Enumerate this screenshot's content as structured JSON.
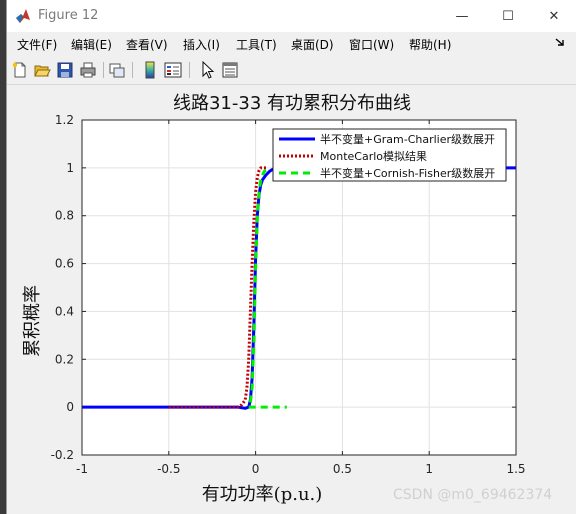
{
  "window": {
    "title": "Figure 12",
    "controls": {
      "minimize": "—",
      "maximize": "☐",
      "close": "✕"
    }
  },
  "menubar": {
    "items": [
      "文件(F)",
      "编辑(E)",
      "查看(V)",
      "插入(I)",
      "工具(T)",
      "桌面(D)",
      "窗口(W)",
      "帮助(H)"
    ],
    "dock_icon": "dock-arrow-icon"
  },
  "toolbar": {
    "icons": [
      "new-figure-icon",
      "open-file-icon",
      "save-icon",
      "print-icon",
      "link-plot-icon",
      "insert-colorbar-icon",
      "insert-legend-icon",
      "edit-plot-arrow-icon",
      "property-inspector-icon"
    ]
  },
  "watermark": "CSDN @m0_69462374",
  "colors": {
    "series1": "#0000ff",
    "series2": "#c00000",
    "series3": "#00ee00"
  },
  "chart_data": {
    "type": "line",
    "title": "线路31-33 有功累积分布曲线",
    "xlabel": "有功功率(p.u.)",
    "ylabel": "累积概率",
    "xlim": [
      -1,
      1.5
    ],
    "ylim": [
      -0.2,
      1.2
    ],
    "xticks": [
      -1,
      -0.5,
      0,
      0.5,
      1,
      1.5
    ],
    "yticks": [
      -0.2,
      0,
      0.2,
      0.4,
      0.6,
      0.8,
      1,
      1.2
    ],
    "xtick_labels": [
      "-1",
      "-0.5",
      "0",
      "0.5",
      "1",
      "1.5"
    ],
    "ytick_labels": [
      "-0.2",
      "0",
      "0.2",
      "0.4",
      "0.6",
      "0.8",
      "1",
      "1.2"
    ],
    "grid": true,
    "legend_position": "top-right",
    "series": [
      {
        "name": "半不变量+Gram-Charlier级数展开",
        "style": "solid",
        "color": "#0000ff",
        "x": [
          -1,
          -0.5,
          -0.1,
          -0.06,
          -0.04,
          -0.03,
          -0.02,
          -0.01,
          0,
          0.01,
          0.02,
          0.03,
          0.04,
          0.06,
          0.08,
          0.1,
          0.15,
          0.2,
          0.5,
          1,
          1.5
        ],
        "y": [
          0,
          0,
          0,
          -0.005,
          0,
          0.03,
          0.12,
          0.35,
          0.62,
          0.8,
          0.89,
          0.93,
          0.95,
          0.97,
          0.985,
          0.995,
          1,
          1,
          1,
          1,
          1
        ]
      },
      {
        "name": "MonteCarlo模拟结果",
        "style": "dotted",
        "color": "#c00000",
        "x": [
          -0.5,
          -0.1,
          -0.08,
          -0.06,
          -0.05,
          -0.04,
          -0.03,
          -0.02,
          -0.01,
          0,
          0.01,
          0.02,
          0.03,
          0.04,
          0.06
        ],
        "y": [
          0,
          0,
          0.01,
          0.03,
          0.08,
          0.2,
          0.4,
          0.6,
          0.78,
          0.9,
          0.96,
          0.99,
          1,
          1,
          1
        ]
      },
      {
        "name": "半不变量+Cornish-Fisher级数展开",
        "style": "dashed",
        "color": "#00ee00",
        "x": [
          -0.04,
          0.0,
          0.1,
          0.18
        ],
        "y": [
          0,
          0,
          0,
          0
        ]
      },
      {
        "name": "半不变量+Cornish-Fisher级数展开",
        "style": "dashed",
        "color": "#00ee00",
        "x": [
          -0.03,
          -0.02,
          -0.01,
          0,
          0.01,
          0.02,
          0.03,
          0.04,
          0.05,
          0.06
        ],
        "y": [
          0.02,
          0.08,
          0.28,
          0.58,
          0.8,
          0.9,
          0.95,
          0.97,
          0.985,
          0.99
        ]
      }
    ]
  }
}
